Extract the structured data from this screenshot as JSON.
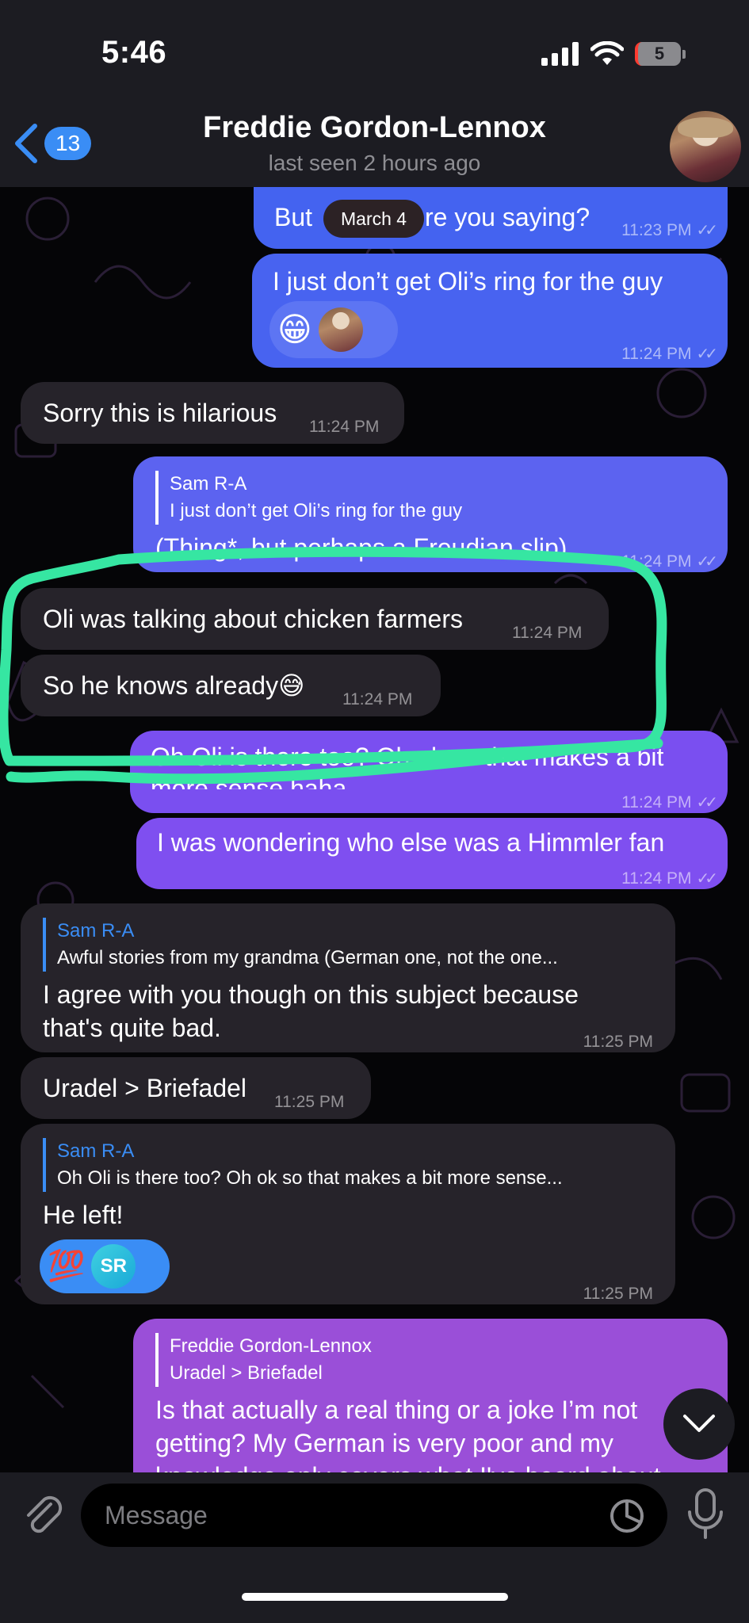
{
  "status_bar": {
    "time": "5:46",
    "battery": "5"
  },
  "header": {
    "back_count": "13",
    "contact_name": "Freddie Gordon-Lennox",
    "contact_status": "last seen 2 hours ago"
  },
  "date_pill": "March 4",
  "messages": [
    {
      "id": "m1",
      "direction": "out",
      "text_before": "But ",
      "text_after": "re you saying?",
      "time": "11:23 PM"
    },
    {
      "id": "m2",
      "direction": "out",
      "text": "I just don’t get Oli’s ring for the guy",
      "time": "11:24 PM"
    },
    {
      "id": "m3",
      "direction": "in",
      "text": "Sorry this is hilarious",
      "time": "11:24 PM"
    },
    {
      "id": "m4",
      "direction": "out",
      "reply_name": "Sam R-A",
      "reply_text": "I just don’t get Oli’s ring for the guy",
      "text": "(Thing*, but perhaps a Freudian slip)",
      "time": "11:24 PM"
    },
    {
      "id": "m5",
      "direction": "in",
      "text": "Oli was talking about chicken farmers",
      "time": "11:24 PM"
    },
    {
      "id": "m6",
      "direction": "in",
      "text": "So he knows already",
      "emoji": "😅",
      "time": "11:24 PM"
    },
    {
      "id": "m7",
      "direction": "out",
      "text": "Oh Oli is there too? Oh ok so that makes a bit",
      "text2": "more sense haha",
      "time": "11:24 PM"
    },
    {
      "id": "m8",
      "direction": "out",
      "text": "I was wondering who else was a Himmler fan",
      "time": "11:24 PM"
    },
    {
      "id": "m9",
      "direction": "in",
      "reply_name": "Sam R-A",
      "reply_text": "Awful stories from my grandma (German one, not the one...",
      "text": "I agree with you though on this subject because",
      "text2": "that's quite bad.",
      "time": "11:25 PM"
    },
    {
      "id": "m10",
      "direction": "in",
      "text": "Uradel > Briefadel",
      "time": "11:25 PM"
    },
    {
      "id": "m11",
      "direction": "in",
      "reply_name": "Sam R-A",
      "reply_text": "Oh Oli is there too? Oh ok so that makes a bit more sense...",
      "text": "He left!",
      "reaction_emoji": "💯",
      "reaction_initials": "SR",
      "time": "11:25 PM"
    },
    {
      "id": "m12",
      "direction": "out",
      "reply_name": "Freddie Gordon-Lennox",
      "reply_text": "Uradel > Briefadel",
      "text": "Is that actually a real thing or a joke I’m not",
      "text2": "getting? My German is very poor and my",
      "text3": "knowledge only covers what I've heard about"
    }
  ],
  "reactions": {
    "m2_emoji": "😁"
  },
  "input": {
    "placeholder": "Message"
  },
  "icons": [
    "back-chevron-icon",
    "attach-icon",
    "sticker-icon",
    "mic-icon",
    "chevron-down-icon",
    "signal-icon",
    "wifi-icon",
    "battery-icon"
  ],
  "colors": {
    "accent": "#3a8df5",
    "incoming_bubble": "#26232a",
    "highlight_scribble": "#36e6a2"
  }
}
